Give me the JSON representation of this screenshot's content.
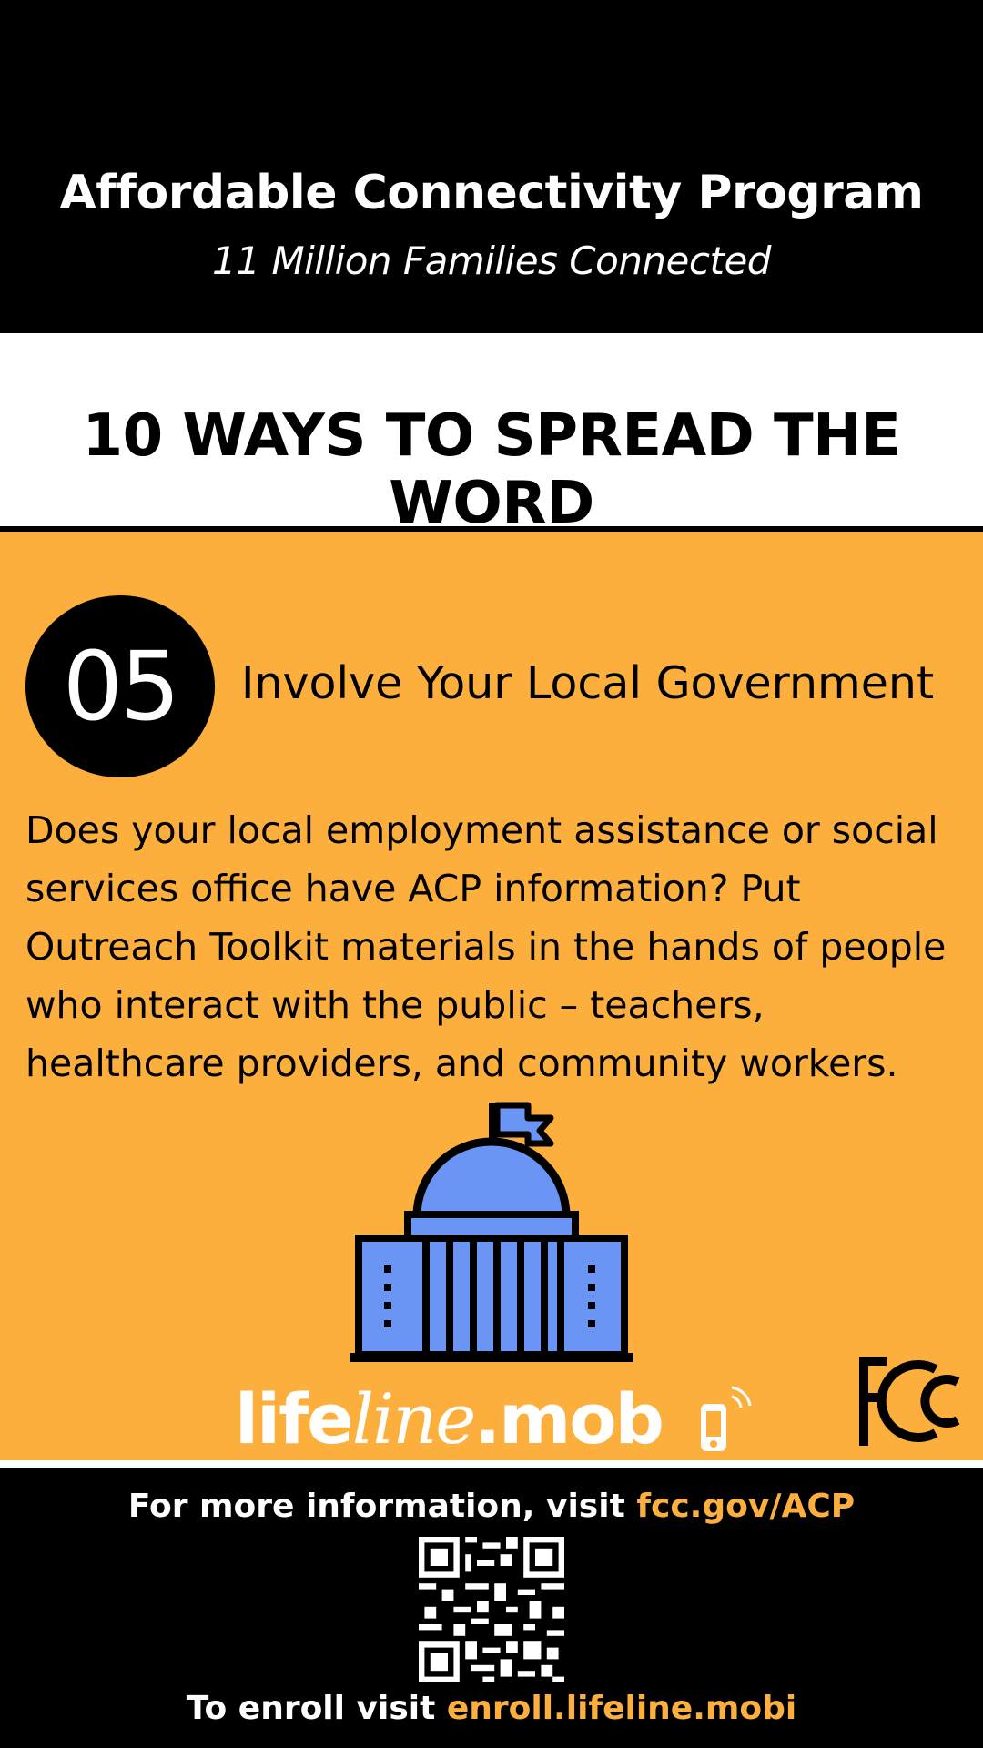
{
  "progress": {
    "total": 10,
    "completed": 5
  },
  "header": {
    "title": "Affordable Connectivity Program",
    "subtitle": "11 Million Families Connected"
  },
  "band": {
    "heading": "10 WAYS TO SPREAD THE WORD"
  },
  "tip": {
    "number": "05",
    "title": "Involve Your Local Government",
    "body": "Does your local employment assistance or social services office have ACP information? Put Outreach Toolkit materials in the hands of people who interact with the public – teachers, healthcare providers, and community workers."
  },
  "logo": {
    "part1": "life",
    "part2": "line",
    "part3": ".mob"
  },
  "footer": {
    "more_prefix": "For more information, visit ",
    "more_link": "fcc.gov/ACP",
    "enroll_prefix": "To enroll visit ",
    "enroll_link": "enroll.lifeline.mobi"
  },
  "colors": {
    "accent": "#fdaf3d",
    "building": "#6b95f5",
    "background": "#000000"
  },
  "icons": [
    "government-building-icon",
    "fcc-logo",
    "lifeline-mobi-logo",
    "qr-code"
  ]
}
